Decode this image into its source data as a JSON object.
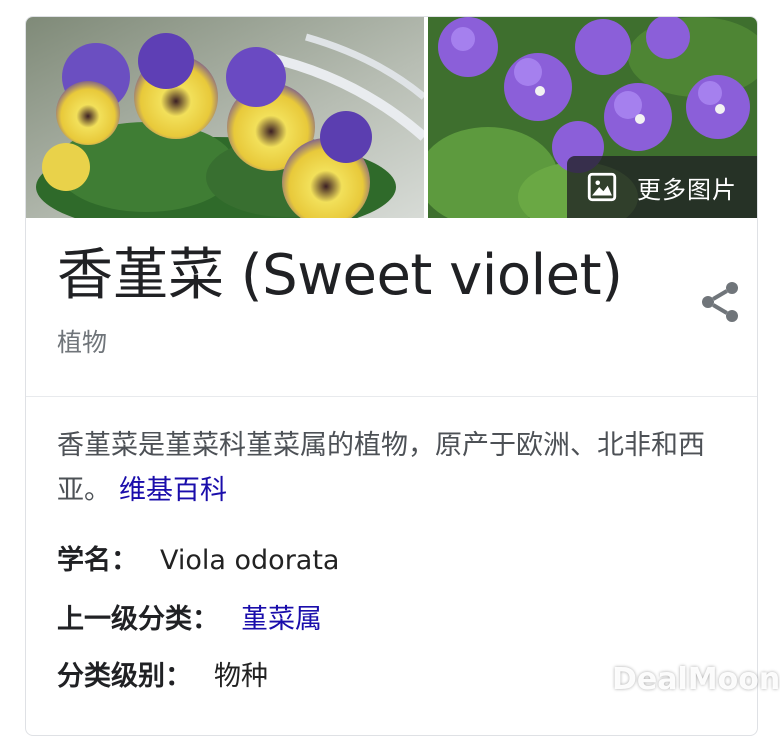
{
  "images": {
    "more_images_label": "更多图片",
    "left_photo": "pansy photo",
    "right_photo": "violet photo"
  },
  "title": "香堇菜 (Sweet violet)",
  "subtitle": "植物",
  "description": {
    "text": "香堇菜是堇菜科堇菜属的植物，原产于欧洲、北非和西亚。",
    "source_link": "维基百科"
  },
  "facts": [
    {
      "key": "学名：",
      "value": "Viola odorata"
    },
    {
      "key": "上一级分类：",
      "value": "堇菜属"
    },
    {
      "key": "分类级别：",
      "value": "物种"
    }
  ],
  "watermark": {
    "text": "DealMoon"
  },
  "icons": {
    "share": "share-icon",
    "image": "image-icon"
  },
  "colors": {
    "link": "#1a0dab",
    "secondary_text": "#70757a",
    "overlay": "#202124"
  }
}
